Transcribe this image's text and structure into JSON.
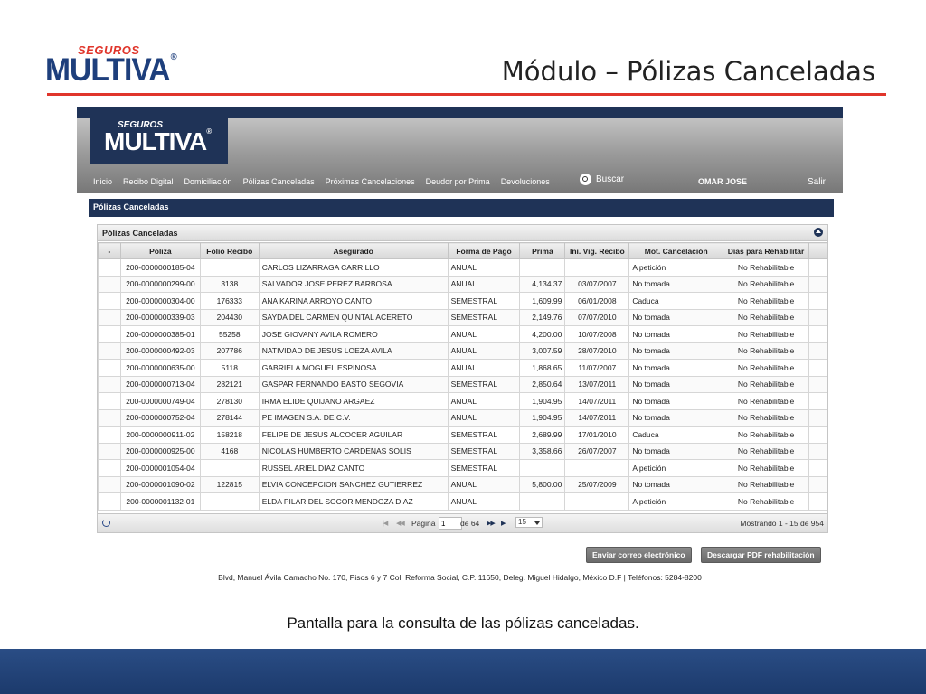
{
  "slide": {
    "logo_brand": "SEGUROS",
    "logo_name": "MULTIVA",
    "logo_reg": "®",
    "title": "Módulo – Pólizas Canceladas",
    "caption": "Pantalla para la consulta de las pólizas canceladas.",
    "accent_color": "#e0352b",
    "brand_color": "#1f3357"
  },
  "app": {
    "logo_brand": "SEGUROS",
    "logo_name": "MULTIVA",
    "logo_reg": "®",
    "nav": [
      {
        "label": "Inicio"
      },
      {
        "label": "Recibo Digital"
      },
      {
        "label": "Domiciliación"
      },
      {
        "label": "Pólizas Canceladas"
      },
      {
        "label": "Próximas Cancelaciones"
      },
      {
        "label": "Deudor por Prima"
      },
      {
        "label": "Devoluciones"
      }
    ],
    "search_label": "Buscar",
    "user_name": "OMAR JOSE",
    "logout_label": "Salir",
    "section_title": "Pólizas Canceladas",
    "footer_address": "Blvd, Manuel Ávila Camacho No. 170, Pisos 6 y 7 Col. Reforma Social, C.P. 11650, Deleg. Miguel Hidalgo, México D.F | Teléfonos: 5284-8200"
  },
  "grid": {
    "title": "Pólizas Canceladas",
    "columns": [
      "-",
      "Póliza",
      "Folio Recibo",
      "Asegurado",
      "Forma de Pago",
      "Prima",
      "Ini. Vig. Recibo",
      "Mot. Cancelación",
      "Días para Rehabilitar"
    ],
    "rows": [
      {
        "poliza": "200-0000000185-04",
        "folio": "",
        "asegurado": "CARLOS LIZARRAGA CARRILLO",
        "forma": "ANUAL",
        "prima": "",
        "inicio": "",
        "motivo": "A petición",
        "dias": "No Rehabilitable"
      },
      {
        "poliza": "200-0000000299-00",
        "folio": "3138",
        "asegurado": "SALVADOR JOSE PEREZ BARBOSA",
        "forma": "ANUAL",
        "prima": "4,134.37",
        "inicio": "03/07/2007",
        "motivo": "No tomada",
        "dias": "No Rehabilitable"
      },
      {
        "poliza": "200-0000000304-00",
        "folio": "176333",
        "asegurado": "ANA KARINA ARROYO CANTO",
        "forma": "SEMESTRAL",
        "prima": "1,609.99",
        "inicio": "06/01/2008",
        "motivo": "Caduca",
        "dias": "No Rehabilitable"
      },
      {
        "poliza": "200-0000000339-03",
        "folio": "204430",
        "asegurado": "SAYDA DEL CARMEN QUINTAL ACERETO",
        "forma": "SEMESTRAL",
        "prima": "2,149.76",
        "inicio": "07/07/2010",
        "motivo": "No tomada",
        "dias": "No Rehabilitable"
      },
      {
        "poliza": "200-0000000385-01",
        "folio": "55258",
        "asegurado": "JOSE GIOVANY AVILA ROMERO",
        "forma": "ANUAL",
        "prima": "4,200.00",
        "inicio": "10/07/2008",
        "motivo": "No tomada",
        "dias": "No Rehabilitable"
      },
      {
        "poliza": "200-0000000492-03",
        "folio": "207786",
        "asegurado": "NATIVIDAD DE JESUS LOEZA AVILA",
        "forma": "ANUAL",
        "prima": "3,007.59",
        "inicio": "28/07/2010",
        "motivo": "No tomada",
        "dias": "No Rehabilitable"
      },
      {
        "poliza": "200-0000000635-00",
        "folio": "5118",
        "asegurado": "GABRIELA MOGUEL ESPINOSA",
        "forma": "ANUAL",
        "prima": "1,868.65",
        "inicio": "11/07/2007",
        "motivo": "No tomada",
        "dias": "No Rehabilitable"
      },
      {
        "poliza": "200-0000000713-04",
        "folio": "282121",
        "asegurado": "GASPAR FERNANDO BASTO SEGOVIA",
        "forma": "SEMESTRAL",
        "prima": "2,850.64",
        "inicio": "13/07/2011",
        "motivo": "No tomada",
        "dias": "No Rehabilitable"
      },
      {
        "poliza": "200-0000000749-04",
        "folio": "278130",
        "asegurado": "IRMA ELIDE QUIJANO ARGAEZ",
        "forma": "ANUAL",
        "prima": "1,904.95",
        "inicio": "14/07/2011",
        "motivo": "No tomada",
        "dias": "No Rehabilitable"
      },
      {
        "poliza": "200-0000000752-04",
        "folio": "278144",
        "asegurado": "PE IMAGEN S.A. DE C.V.",
        "forma": "ANUAL",
        "prima": "1,904.95",
        "inicio": "14/07/2011",
        "motivo": "No tomada",
        "dias": "No Rehabilitable"
      },
      {
        "poliza": "200-0000000911-02",
        "folio": "158218",
        "asegurado": "FELIPE DE JESUS ALCOCER AGUILAR",
        "forma": "SEMESTRAL",
        "prima": "2,689.99",
        "inicio": "17/01/2010",
        "motivo": "Caduca",
        "dias": "No Rehabilitable"
      },
      {
        "poliza": "200-0000000925-00",
        "folio": "4168",
        "asegurado": "NICOLAS HUMBERTO CARDENAS SOLIS",
        "forma": "SEMESTRAL",
        "prima": "3,358.66",
        "inicio": "26/07/2007",
        "motivo": "No tomada",
        "dias": "No Rehabilitable"
      },
      {
        "poliza": "200-0000001054-04",
        "folio": "",
        "asegurado": "RUSSEL ARIEL DIAZ CANTO",
        "forma": "SEMESTRAL",
        "prima": "",
        "inicio": "",
        "motivo": "A petición",
        "dias": "No Rehabilitable"
      },
      {
        "poliza": "200-0000001090-02",
        "folio": "122815",
        "asegurado": "ELVIA CONCEPCION SANCHEZ GUTIERREZ",
        "forma": "ANUAL",
        "prima": "5,800.00",
        "inicio": "25/07/2009",
        "motivo": "No tomada",
        "dias": "No Rehabilitable"
      },
      {
        "poliza": "200-0000001132-01",
        "folio": "",
        "asegurado": "ELDA PILAR DEL SOCOR MENDOZA DIAZ",
        "forma": "ANUAL",
        "prima": "",
        "inicio": "",
        "motivo": "A petición",
        "dias": "No Rehabilitable"
      }
    ],
    "pager": {
      "page_label": "Página",
      "page_value": "1",
      "of_label": "de 64",
      "page_size": "15",
      "info": "Mostrando 1 - 15 de 954"
    }
  },
  "buttons": {
    "email": "Enviar correo electrónico",
    "pdf": "Descargar PDF rehabilitación"
  }
}
